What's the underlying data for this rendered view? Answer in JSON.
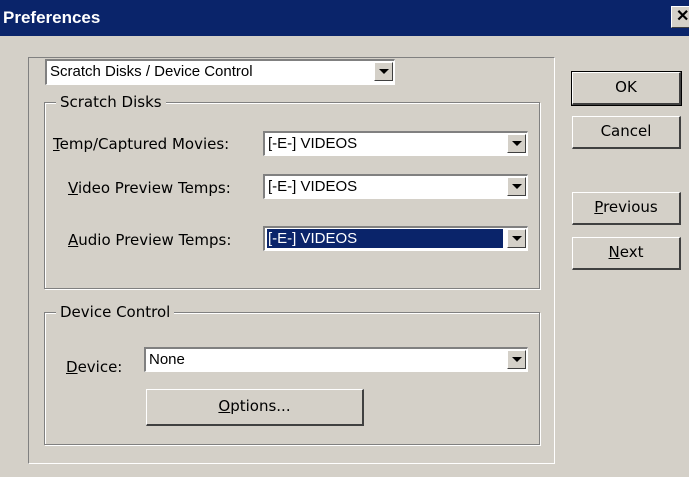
{
  "window": {
    "title": "Preferences",
    "close_glyph": "✕"
  },
  "category": {
    "value": "Scratch Disks / Device Control"
  },
  "scratch_disks": {
    "group_label": "Scratch Disks",
    "temp_captured": {
      "label_accel": "T",
      "label_rest": "emp/Captured Movies:",
      "value": "[-E-] VIDEOS"
    },
    "video_preview": {
      "label_accel": "V",
      "label_rest": "ideo Preview Temps:",
      "value": "[-E-] VIDEOS"
    },
    "audio_preview": {
      "label_accel": "A",
      "label_rest": "udio Preview Temps:",
      "value": "[-E-] VIDEOS"
    }
  },
  "device_control": {
    "group_label": "Device Control",
    "device_label_accel": "D",
    "device_label_rest": "evice:",
    "device_value": "None",
    "options_accel": "O",
    "options_rest": "ptions..."
  },
  "buttons": {
    "ok": "OK",
    "cancel": "Cancel",
    "previous_accel": "P",
    "previous_rest": "revious",
    "next_accel": "N",
    "next_rest": "ext"
  },
  "icons": {
    "dropdown": "chevron-down-icon",
    "close": "close-icon"
  },
  "colors": {
    "title_bar": "#0a246a",
    "face": "#d4d0c8",
    "selection": "#0a246a"
  }
}
